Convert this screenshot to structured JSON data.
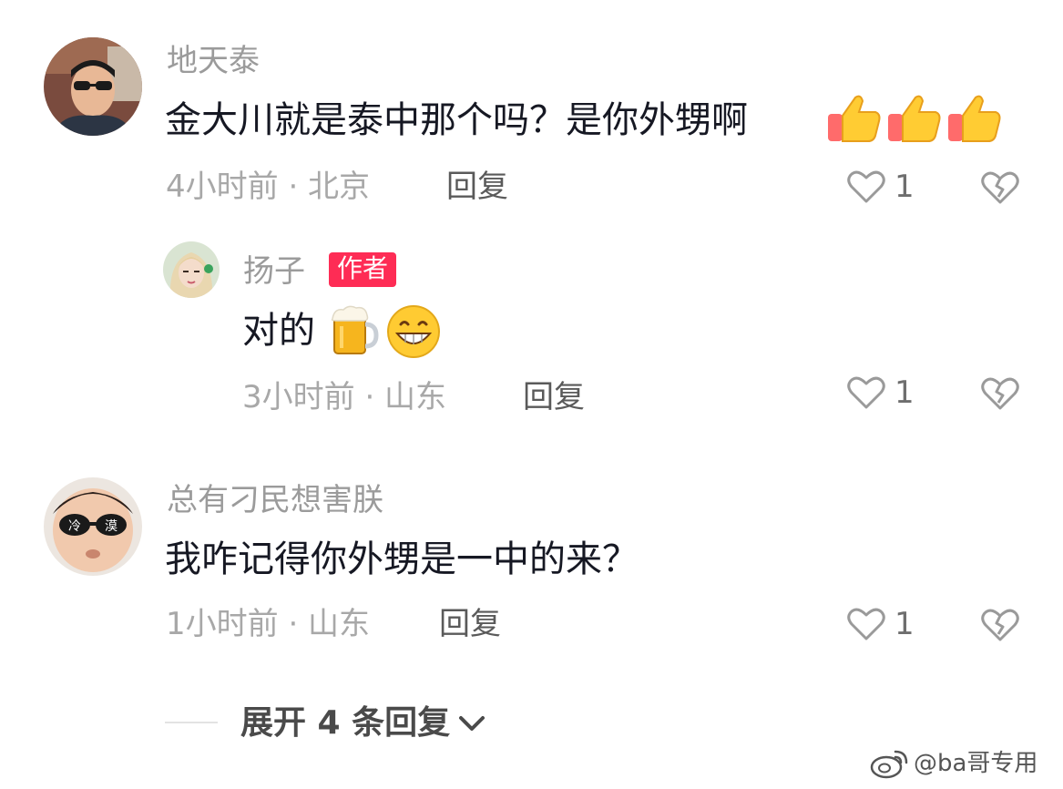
{
  "comments": [
    {
      "username": "地天泰",
      "text": "金大川就是泰中那个吗？是你外甥啊",
      "emojis": [
        "thumbs-up",
        "thumbs-up",
        "thumbs-up"
      ],
      "meta": "4小时前 · 北京",
      "reply_label": "回复",
      "likes": "1",
      "avatar_icon": "avatar-man-sunglasses-icon",
      "replies": [
        {
          "username": "扬子",
          "badge": "作者",
          "text": "对的",
          "emojis": [
            "beer",
            "grin"
          ],
          "meta": "3小时前 · 山东",
          "reply_label": "回复",
          "likes": "1",
          "avatar_icon": "avatar-woman-icon"
        }
      ]
    },
    {
      "username": "总有刁民想害朕",
      "text": "我咋记得你外甥是一中的来？",
      "meta": "1小时前 · 山东",
      "reply_label": "回复",
      "likes": "1",
      "avatar_icon": "avatar-baby-sunglasses-icon",
      "avatar_glasses_text": [
        "冷",
        "漠"
      ]
    }
  ],
  "expand": {
    "label": "展开 4 条回复"
  },
  "watermark": {
    "text": "@ba哥专用"
  },
  "colors": {
    "background": "#ffffff",
    "username": "#9b9b9b",
    "text": "#161823",
    "meta": "#a8a8a8",
    "badge": "#fe2c55"
  }
}
